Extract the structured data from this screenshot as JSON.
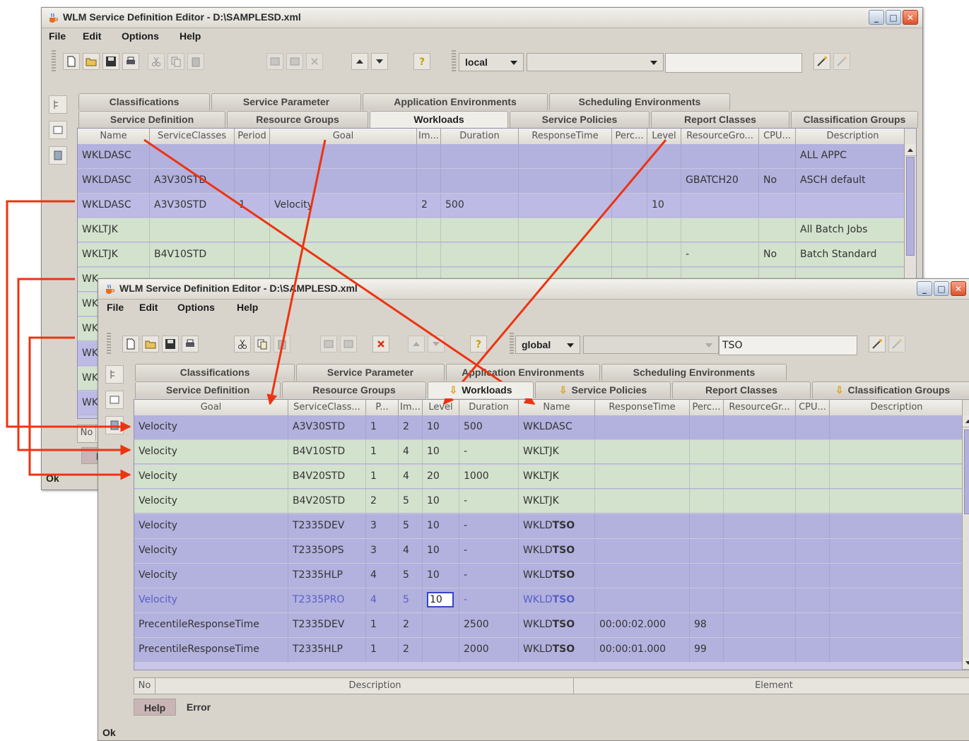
{
  "back_window": {
    "title": "WLM Service Definition Editor - D:\\SAMPLESD.xml",
    "menu": [
      "File",
      "Edit",
      "Options",
      "Help"
    ],
    "scope_combo": "local",
    "search_value": "",
    "tabs_row1": [
      "Classifications",
      "Service Parameter",
      "Application Environments",
      "Scheduling Environments"
    ],
    "tabs_row2": [
      "Service Definition",
      "Resource Groups",
      "Workloads",
      "Service Policies",
      "Report Classes",
      "Classification Groups"
    ],
    "columns": [
      "Name",
      "ServiceClasses",
      "Period",
      "Goal",
      "Im...",
      "Duration",
      "ResponseTime",
      "Perc...",
      "Level",
      "ResourceGro...",
      "CPU...",
      "Description"
    ],
    "rows": [
      {
        "name": "WKLDASC",
        "sc": "",
        "period": "",
        "goal": "",
        "im": "",
        "dur": "",
        "rt": "",
        "perc": "",
        "level": "",
        "rg": "",
        "cpu": "",
        "desc": "ALL APPC"
      },
      {
        "name": "WKLDASC",
        "sc": "A3V30STD",
        "period": "",
        "goal": "",
        "im": "",
        "dur": "",
        "rt": "",
        "perc": "",
        "level": "",
        "rg": "GBATCH20",
        "cpu": "No",
        "desc": "ASCH default"
      },
      {
        "name": "WKLDASC",
        "sc": "A3V30STD",
        "period": "1",
        "goal": "Velocity",
        "im": "2",
        "dur": "500",
        "rt": "",
        "perc": "",
        "level": "10",
        "rg": "",
        "cpu": "",
        "desc": ""
      },
      {
        "name": "WKLTJK",
        "sc": "",
        "period": "",
        "goal": "",
        "im": "",
        "dur": "",
        "rt": "",
        "perc": "",
        "level": "",
        "rg": "",
        "cpu": "",
        "desc": "All Batch Jobs"
      },
      {
        "name": "WKLTJK",
        "sc": "B4V10STD",
        "period": "",
        "goal": "",
        "im": "",
        "dur": "",
        "rt": "",
        "perc": "",
        "level": "",
        "rg": "-",
        "cpu": "No",
        "desc": "Batch Standard"
      },
      {
        "name": "WK",
        "sc": "",
        "period": "",
        "goal": "",
        "im": "",
        "dur": "",
        "rt": "",
        "perc": "",
        "level": "",
        "rg": "",
        "cpu": "",
        "desc": ""
      },
      {
        "name": "WK",
        "sc": "",
        "period": "",
        "goal": "",
        "im": "",
        "dur": "",
        "rt": "",
        "perc": "",
        "level": "",
        "rg": "",
        "cpu": "",
        "desc": ""
      },
      {
        "name": "WK",
        "sc": "",
        "period": "",
        "goal": "",
        "im": "",
        "dur": "",
        "rt": "",
        "perc": "",
        "level": "",
        "rg": "",
        "cpu": "",
        "desc": ""
      },
      {
        "name": "WK",
        "sc": "",
        "period": "",
        "goal": "",
        "im": "",
        "dur": "",
        "rt": "",
        "perc": "",
        "level": "",
        "rg": "",
        "cpu": "",
        "desc": ""
      },
      {
        "name": "WK",
        "sc": "",
        "period": "",
        "goal": "",
        "im": "",
        "dur": "",
        "rt": "",
        "perc": "",
        "level": "",
        "rg": "",
        "cpu": "",
        "desc": ""
      },
      {
        "name": "WK",
        "sc": "",
        "period": "",
        "goal": "",
        "im": "",
        "dur": "",
        "rt": "",
        "perc": "",
        "level": "",
        "rg": "",
        "cpu": "",
        "desc": ""
      }
    ],
    "bottom_no": "No",
    "bottom_tab": "He",
    "status": "Ok"
  },
  "front_window": {
    "title": "WLM Service Definition Editor - D:\\SAMPLESD.xml",
    "menu": [
      "File",
      "Edit",
      "Options",
      "Help"
    ],
    "scope_combo": "global",
    "search_value": "TSO",
    "tabs_row1": [
      "Classifications",
      "Service Parameter",
      "Application Environments",
      "Scheduling Environments"
    ],
    "tabs_row2": [
      "Service Definition",
      "Resource Groups",
      "Workloads",
      "Service Policies",
      "Report Classes",
      "Classification Groups"
    ],
    "columns": [
      "Goal",
      "ServiceClass...",
      "P...",
      "Im...",
      "Level",
      "Duration",
      "Name",
      "ResponseTime",
      "Perc...",
      "ResourceGr...",
      "CPU...",
      "Description"
    ],
    "rows": [
      {
        "goal": "Velocity",
        "sc": "A3V30STD",
        "p": "1",
        "im": "2",
        "level": "10",
        "dur": "500",
        "name_a": "WKLDASC",
        "name_b": "",
        "rt": "",
        "perc": "",
        "rg": "",
        "cpu": "",
        "desc": ""
      },
      {
        "goal": "Velocity",
        "sc": "B4V10STD",
        "p": "1",
        "im": "4",
        "level": "10",
        "dur": "-",
        "name_a": "WKLTJK",
        "name_b": "",
        "rt": "",
        "perc": "",
        "rg": "",
        "cpu": "",
        "desc": ""
      },
      {
        "goal": "Velocity",
        "sc": "B4V20STD",
        "p": "1",
        "im": "4",
        "level": "20",
        "dur": "1000",
        "name_a": "WKLTJK",
        "name_b": "",
        "rt": "",
        "perc": "",
        "rg": "",
        "cpu": "",
        "desc": ""
      },
      {
        "goal": "Velocity",
        "sc": "B4V20STD",
        "p": "2",
        "im": "5",
        "level": "10",
        "dur": "-",
        "name_a": "WKLTJK",
        "name_b": "",
        "rt": "",
        "perc": "",
        "rg": "",
        "cpu": "",
        "desc": ""
      },
      {
        "goal": "Velocity",
        "sc": "T2335DEV",
        "p": "3",
        "im": "5",
        "level": "10",
        "dur": "-",
        "name_a": "WKLD",
        "name_b": "TSO",
        "rt": "",
        "perc": "",
        "rg": "",
        "cpu": "",
        "desc": ""
      },
      {
        "goal": "Velocity",
        "sc": "T2335OPS",
        "p": "3",
        "im": "4",
        "level": "10",
        "dur": "-",
        "name_a": "WKLD",
        "name_b": "TSO",
        "rt": "",
        "perc": "",
        "rg": "",
        "cpu": "",
        "desc": ""
      },
      {
        "goal": "Velocity",
        "sc": "T2335HLP",
        "p": "4",
        "im": "5",
        "level": "10",
        "dur": "-",
        "name_a": "WKLD",
        "name_b": "TSO",
        "rt": "",
        "perc": "",
        "rg": "",
        "cpu": "",
        "desc": ""
      },
      {
        "goal": "Velocity",
        "sc": "T2335PRO",
        "p": "4",
        "im": "5",
        "level": "10",
        "dur": "-",
        "name_a": "WKLD",
        "name_b": "TSO",
        "rt": "",
        "perc": "",
        "rg": "",
        "cpu": "",
        "desc": ""
      },
      {
        "goal": "PrecentileResponseTime",
        "sc": "T2335DEV",
        "p": "1",
        "im": "2",
        "level": "",
        "dur": "2500",
        "name_a": "WKLD",
        "name_b": "TSO",
        "rt": "00:00:02.000",
        "perc": "98",
        "rg": "",
        "cpu": "",
        "desc": ""
      },
      {
        "goal": "PrecentileResponseTime",
        "sc": "T2335HLP",
        "p": "1",
        "im": "2",
        "level": "",
        "dur": "2000",
        "name_a": "WKLD",
        "name_b": "TSO",
        "rt": "00:00:01.000",
        "perc": "99",
        "rg": "",
        "cpu": "",
        "desc": ""
      }
    ],
    "bottom_columns": [
      "No",
      "Description",
      "Element"
    ],
    "bottom_tabs": [
      "Help",
      "Error"
    ],
    "status": "Ok"
  },
  "colors": {
    "arrow": "#ee3311",
    "workload_purple": "#b3b1de",
    "workload_green": "#d3e2cd",
    "selection": "#3344cc"
  }
}
